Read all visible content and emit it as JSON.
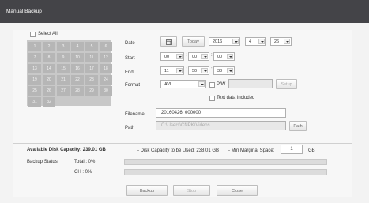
{
  "window": {
    "title": "Manual Backup"
  },
  "select_all": {
    "label": "Select All"
  },
  "calendar": {
    "days": [
      "1",
      "2",
      "3",
      "4",
      "5",
      "6",
      "7",
      "8",
      "9",
      "10",
      "11",
      "12",
      "13",
      "14",
      "15",
      "16",
      "17",
      "18",
      "19",
      "20",
      "21",
      "22",
      "23",
      "24",
      "25",
      "26",
      "27",
      "28",
      "29",
      "30",
      "31",
      "32"
    ]
  },
  "date": {
    "label": "Date",
    "calendar_icon": "calendar-icon",
    "today_label": "Today",
    "year": "2016",
    "month": "4",
    "day": "26"
  },
  "start": {
    "label": "Start",
    "hour": "00",
    "minute": "00",
    "second": "00"
  },
  "end": {
    "label": "End",
    "hour": "11",
    "minute": "50",
    "second": "38"
  },
  "format": {
    "label": "Format",
    "value": "AVI",
    "pw_label": "P/W",
    "setup_label": "Setup",
    "text_data_label": "Text data included"
  },
  "filename": {
    "label": "Filename",
    "value": "20160426_000000"
  },
  "path": {
    "label": "Path",
    "value": "C:\\Users\\CNPK\\Videos",
    "button_label": "Path"
  },
  "capacity": {
    "available": "Available Disk Capacity: 239.01 GB",
    "to_be_used": "- Disk Capacity to be Used: 238.01 GB",
    "min_margin_label": "- Min Marginal Space:",
    "min_margin_value": "1",
    "min_margin_unit": "GB"
  },
  "backup_status": {
    "label": "Backup Status",
    "total": "Total : 0%",
    "ch": "CH : 0%",
    "total_progress": 0,
    "ch_progress": 0
  },
  "actions": {
    "backup": "Backup",
    "stop": "Stop",
    "close": "Close"
  }
}
